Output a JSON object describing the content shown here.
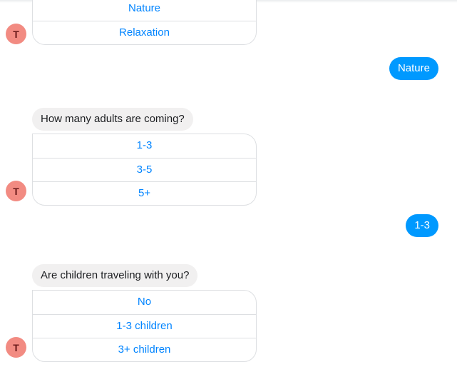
{
  "avatar": {
    "letter": "T",
    "color": "#f28b82"
  },
  "group1": {
    "options": [
      "Nature",
      "Relaxation"
    ]
  },
  "user_reply_1": "Nature",
  "group2": {
    "question": "How many adults are coming?",
    "options": [
      "1-3",
      "3-5",
      "5+"
    ]
  },
  "user_reply_2": "1-3",
  "group3": {
    "question": "Are children traveling with you?",
    "options": [
      "No",
      "1-3 children",
      "3+ children"
    ]
  },
  "colors": {
    "accent": "#0084ff",
    "user_bubble": "#0099ff",
    "bot_bubble": "#f1f0f0"
  }
}
